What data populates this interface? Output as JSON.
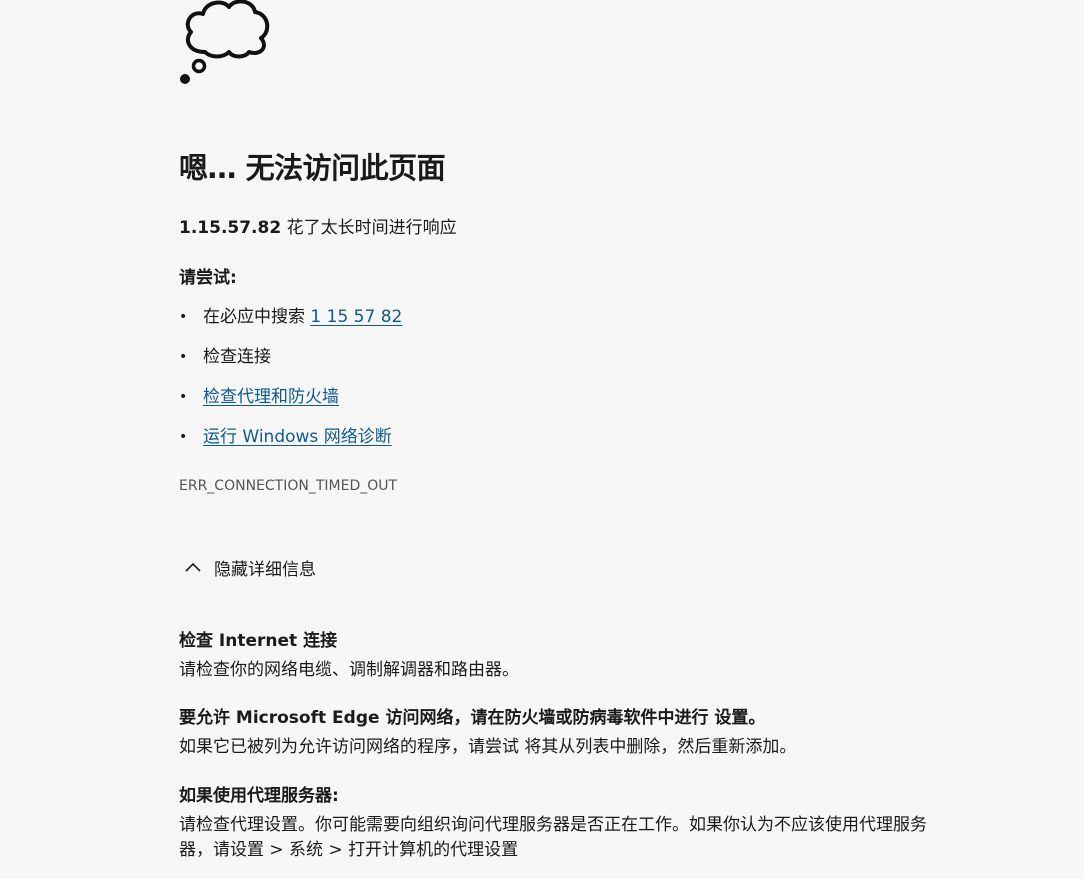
{
  "icon": "thought-cloud-icon",
  "title": "嗯… 无法访问此页面",
  "status": {
    "host": "1.15.57.82",
    "message": " 花了太长时间进行响应"
  },
  "try_heading": "请尝试:",
  "suggestions": [
    {
      "text": "在必应中搜索 ",
      "link": "1 15 57 82"
    },
    {
      "text": "检查连接"
    },
    {
      "link": "检查代理和防火墙"
    },
    {
      "link": "运行 Windows 网络诊断"
    }
  ],
  "error_code": "ERR_CONNECTION_TIMED_OUT",
  "details_toggle": {
    "icon": "chevron-up-icon",
    "label": "隐藏详细信息"
  },
  "details": [
    {
      "title": "检查 Internet 连接",
      "body": "请检查你的网络电缆、调制解调器和路由器。"
    },
    {
      "title": "要允许 Microsoft Edge 访问网络，请在防火墙或防病毒软件中进行 设置。",
      "body": "如果它已被列为允许访问网络的程序，请尝试 将其从列表中删除，然后重新添加。"
    },
    {
      "title": "如果使用代理服务器:",
      "body": "请检查代理设置。你可能需要向组织询问代理服务器是否正在工作。如果你认为不应该使用代理服务器，请设置 > 系统 > 打开计算机的代理设置"
    }
  ]
}
